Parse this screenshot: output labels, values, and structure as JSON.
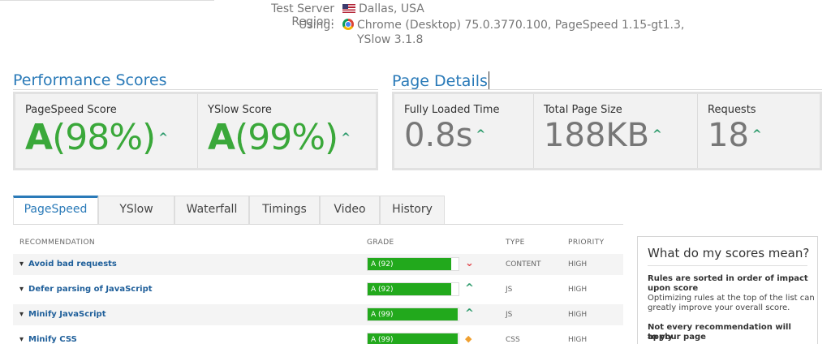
{
  "test_info": {
    "region_label": "Test Server Region:",
    "region_value": "Dallas, USA",
    "region_icon": "us-flag-icon",
    "using_label": "Using:",
    "using_line1": "Chrome (Desktop) 75.0.3770.100, PageSpeed 1.15-gt1.3,",
    "using_line2": "YSlow 3.1.8",
    "using_icon": "chrome-icon"
  },
  "performance": {
    "title": "Performance Scores",
    "scores": [
      {
        "label": "PageSpeed Score",
        "grade": "A",
        "percent": "(98%)"
      },
      {
        "label": "YSlow Score",
        "grade": "A",
        "percent": "(99%)"
      }
    ]
  },
  "details": {
    "title": "Page Details",
    "items": [
      {
        "label": "Fully Loaded Time",
        "value": "0.8s"
      },
      {
        "label": "Total Page Size",
        "value": "188KB"
      },
      {
        "label": "Requests",
        "value": "18"
      }
    ]
  },
  "tabs": [
    {
      "label": "PageSpeed",
      "active": true
    },
    {
      "label": "YSlow",
      "active": false
    },
    {
      "label": "Waterfall",
      "active": false
    },
    {
      "label": "Timings",
      "active": false
    },
    {
      "label": "Video",
      "active": false
    },
    {
      "label": "History",
      "active": false
    }
  ],
  "table": {
    "headers": {
      "recommendation": "RECOMMENDATION",
      "grade": "GRADE",
      "type": "TYPE",
      "priority": "PRIORITY"
    },
    "rows": [
      {
        "title": "Avoid bad requests",
        "grade": "A (92)",
        "grade_value": 0.92,
        "trend": "down",
        "type": "CONTENT",
        "priority": "HIGH"
      },
      {
        "title": "Defer parsing of JavaScript",
        "grade": "A (92)",
        "grade_value": 0.92,
        "trend": "up",
        "type": "JS",
        "priority": "HIGH"
      },
      {
        "title": "Minify JavaScript",
        "grade": "A (99)",
        "grade_value": 0.99,
        "trend": "up",
        "type": "JS",
        "priority": "HIGH"
      },
      {
        "title": "Minify CSS",
        "grade": "A (99)",
        "grade_value": 0.99,
        "trend": "neutral",
        "type": "CSS",
        "priority": "HIGH"
      }
    ]
  },
  "aside": {
    "title": "What do my scores mean?",
    "p1_strong_line1": "Rules are sorted in order of impact",
    "p1_strong_line2": "upon score",
    "p1_text_line1": "Optimizing rules at the top of the list can",
    "p1_text_line2": "greatly improve your overall score.",
    "p2_strong_line1": "Not every recommendation will apply",
    "p2_strong_line2": "to your page"
  },
  "colors": {
    "accent": "#2a7ab8",
    "grade_green": "#3aa83a",
    "bar_green": "#22a91c",
    "trend_up": "#2b9a6a",
    "trend_down": "#e0474c",
    "trend_neutral": "#f0a030"
  }
}
